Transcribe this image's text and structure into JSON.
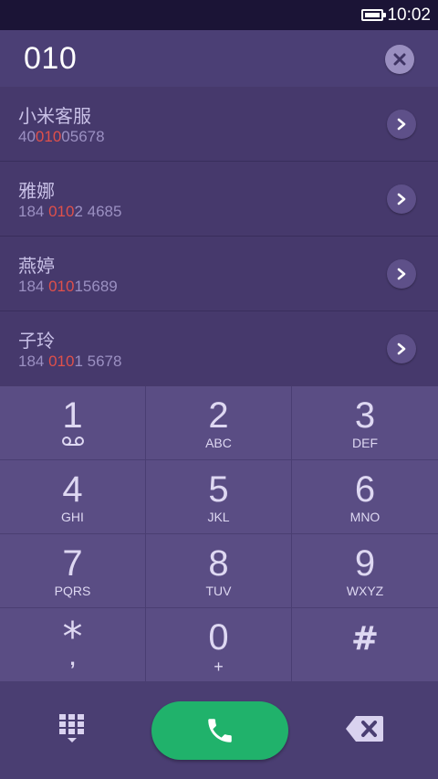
{
  "status": {
    "time": "10:02"
  },
  "entry": {
    "number": "010"
  },
  "contacts": [
    {
      "name": "小米客服",
      "number_pre": "40",
      "number_match": "010",
      "number_post": "05678"
    },
    {
      "name": "雅娜",
      "number_pre": "184 ",
      "number_match": "010",
      "number_post": "2 4685"
    },
    {
      "name": "燕婷",
      "number_pre": "184 ",
      "number_match": "010",
      "number_post": "15689"
    },
    {
      "name": "子玲",
      "number_pre": "184 ",
      "number_match": "010",
      "number_post": "1 5678"
    }
  ],
  "keys": [
    {
      "digit": "1",
      "letters": ""
    },
    {
      "digit": "2",
      "letters": "ABC"
    },
    {
      "digit": "3",
      "letters": "DEF"
    },
    {
      "digit": "4",
      "letters": "GHI"
    },
    {
      "digit": "5",
      "letters": "JKL"
    },
    {
      "digit": "6",
      "letters": "MNO"
    },
    {
      "digit": "7",
      "letters": "PQRS"
    },
    {
      "digit": "8",
      "letters": "TUV"
    },
    {
      "digit": "9",
      "letters": "WXYZ"
    },
    {
      "digit": "*",
      "letters": ","
    },
    {
      "digit": "0",
      "letters": "+"
    },
    {
      "digit": "#",
      "letters": ""
    }
  ],
  "colors": {
    "highlight": "#e0504a",
    "call_green": "#20b26b",
    "background": "#3f3464"
  },
  "icons": {
    "clear": "close-icon",
    "contact_action": "chevron-right-icon",
    "voicemail": "voicemail-icon",
    "dialpad_toggle": "dialpad-grid-icon",
    "call": "phone-icon",
    "backspace": "backspace-icon"
  }
}
